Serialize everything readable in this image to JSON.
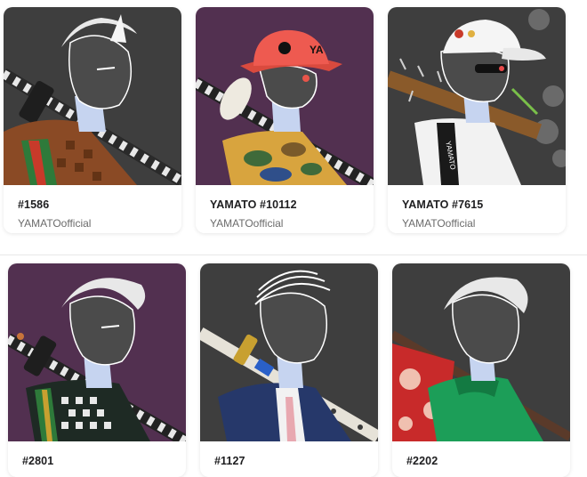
{
  "cards": [
    {
      "title": "#1586",
      "creator": "YAMATOofficial",
      "bg": "#3e3e3e",
      "outfit": "gucci-jacket",
      "accent": "#b84a2c"
    },
    {
      "title": "YAMATO #10112",
      "creator": "YAMATOofficial",
      "bg": "#523050",
      "outfit": "camo-shirt",
      "accent": "#e8554a"
    },
    {
      "title": "YAMATO #7615",
      "creator": "YAMATOofficial",
      "bg": "#3e3e3e",
      "outfit": "white-jacket",
      "accent": "#a06a3a"
    },
    {
      "title": "#2801",
      "creator": "",
      "bg": "#523050",
      "outfit": "checker-shirt",
      "accent": "#2f3d36"
    },
    {
      "title": "#1127",
      "creator": "",
      "bg": "#3e3e3e",
      "outfit": "navy-suit",
      "accent": "#2c3f76"
    },
    {
      "title": "#2202",
      "creator": "",
      "bg": "#3e3e3e",
      "outfit": "green-hoodie",
      "accent": "#1c9e58"
    }
  ]
}
